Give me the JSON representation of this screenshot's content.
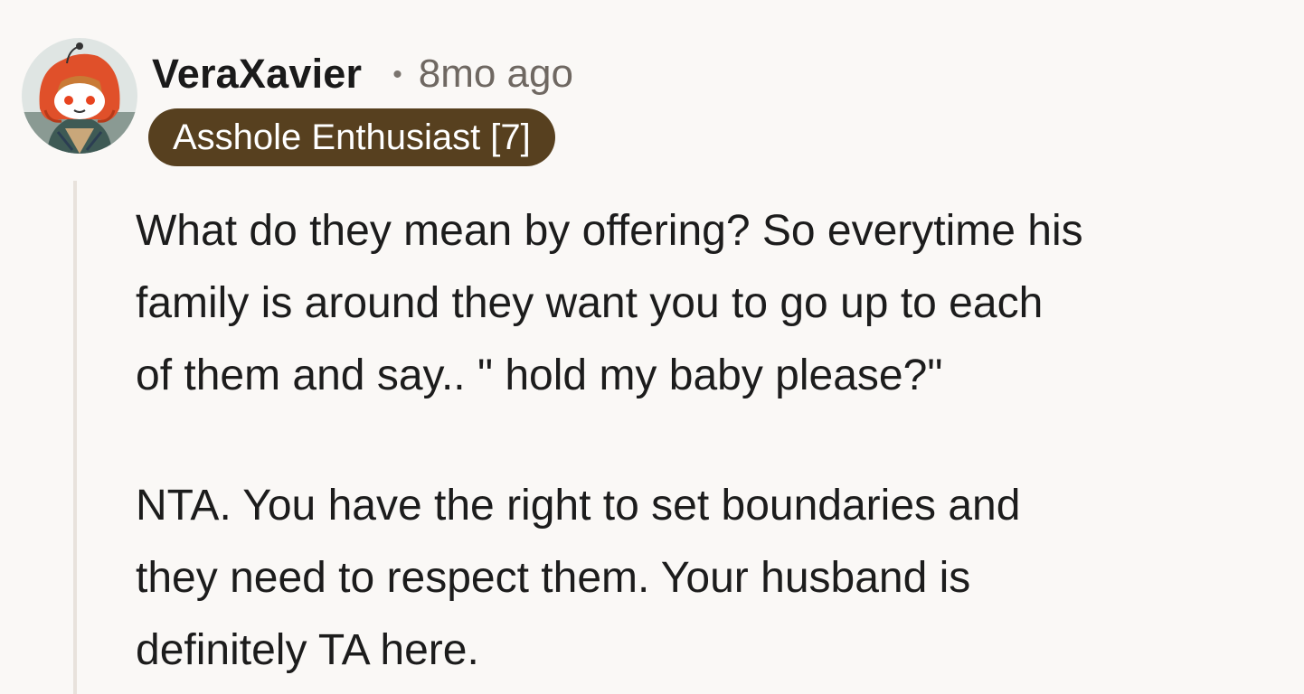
{
  "comment": {
    "author": "VeraXavier",
    "separator": "•",
    "timestamp": "8mo ago",
    "flair": "Asshole Enthusiast [7]",
    "avatar_icon": "snoo-avatar-icon",
    "paragraphs": [
      "What do they mean by offering? So everytime his\nfamily is around they want you to go up to each\nof them and say.. \" hold my baby please?\"",
      "NTA. You have the right to set boundaries and\nthey need to respect them. Your husband is\ndefinitely TA here."
    ]
  },
  "colors": {
    "background": "#faf8f6",
    "flair_background": "#57401f",
    "flair_text": "#ffffff",
    "thread_line": "#e8e2dc",
    "avatar_hood": "#e0502a"
  }
}
